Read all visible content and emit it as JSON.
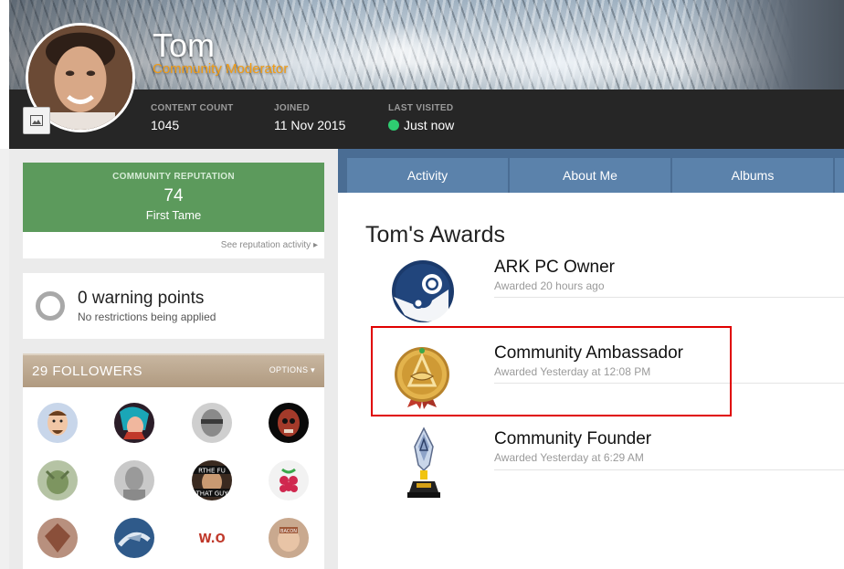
{
  "profile": {
    "name": "Tom",
    "title": "Community Moderator",
    "stats": {
      "content_count_label": "CONTENT COUNT",
      "content_count": "1045",
      "joined_label": "JOINED",
      "joined": "11 Nov 2015",
      "last_visited_label": "LAST VISITED",
      "last_visited": "Just now"
    }
  },
  "reputation": {
    "label": "COMMUNITY REPUTATION",
    "value": "74",
    "rank": "First Tame",
    "link": "See reputation activity"
  },
  "warnings": {
    "title": "0 warning points",
    "subtitle": "No restrictions being applied"
  },
  "followers": {
    "title": "29 FOLLOWERS",
    "options": "OPTIONS",
    "badge_text_1": "RTHE FU",
    "badge_text_2": "THAT GUY",
    "badge_text_3": "W.O",
    "badge_text_4": "BACON"
  },
  "tabs": [
    {
      "label": "Activity"
    },
    {
      "label": "About Me"
    },
    {
      "label": "Albums"
    }
  ],
  "awards": {
    "heading": "Tom's Awards",
    "items": [
      {
        "name": "ARK PC Owner",
        "date": "Awarded 20 hours ago"
      },
      {
        "name": "Community Ambassador",
        "date": "Awarded Yesterday at 12:08 PM"
      },
      {
        "name": "Community Founder",
        "date": "Awarded Yesterday at 6:29 AM"
      }
    ]
  },
  "colors": {
    "reputation_green": "#5c9a5c",
    "moderator_orange": "#f39c12",
    "tab_blue": "#5b82ab",
    "online_green": "#2ecc71",
    "highlight_red": "#e00000"
  }
}
